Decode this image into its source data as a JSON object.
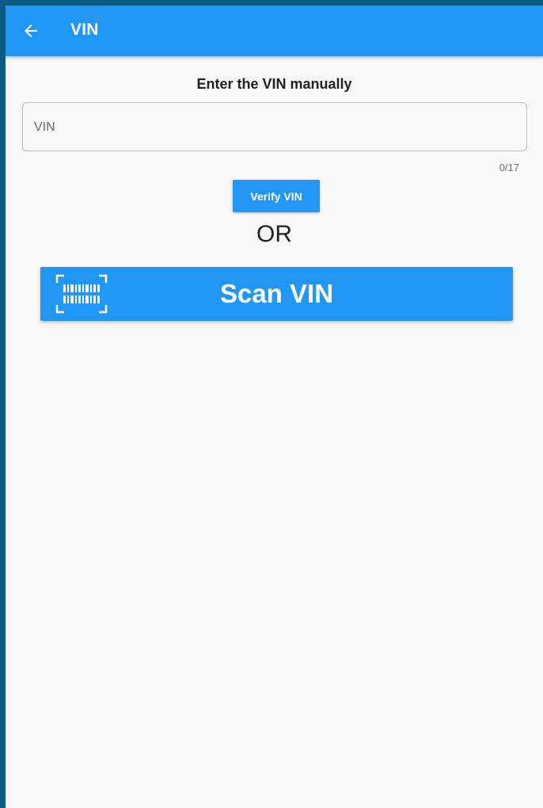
{
  "app_bar": {
    "title": "VIN",
    "back_icon": "arrow-left-icon"
  },
  "manual_entry": {
    "heading": "Enter the VIN manually",
    "vin_field": {
      "placeholder": "VIN",
      "value": ""
    },
    "counter": "0/17",
    "verify_label": "Verify VIN"
  },
  "divider_text": "OR",
  "scan": {
    "label": "Scan VIN",
    "icon": "barcode-scan-icon"
  },
  "colors": {
    "primary": "#2196f3",
    "background": "#f8f8f8",
    "outer_frame": "#0b5a86"
  }
}
